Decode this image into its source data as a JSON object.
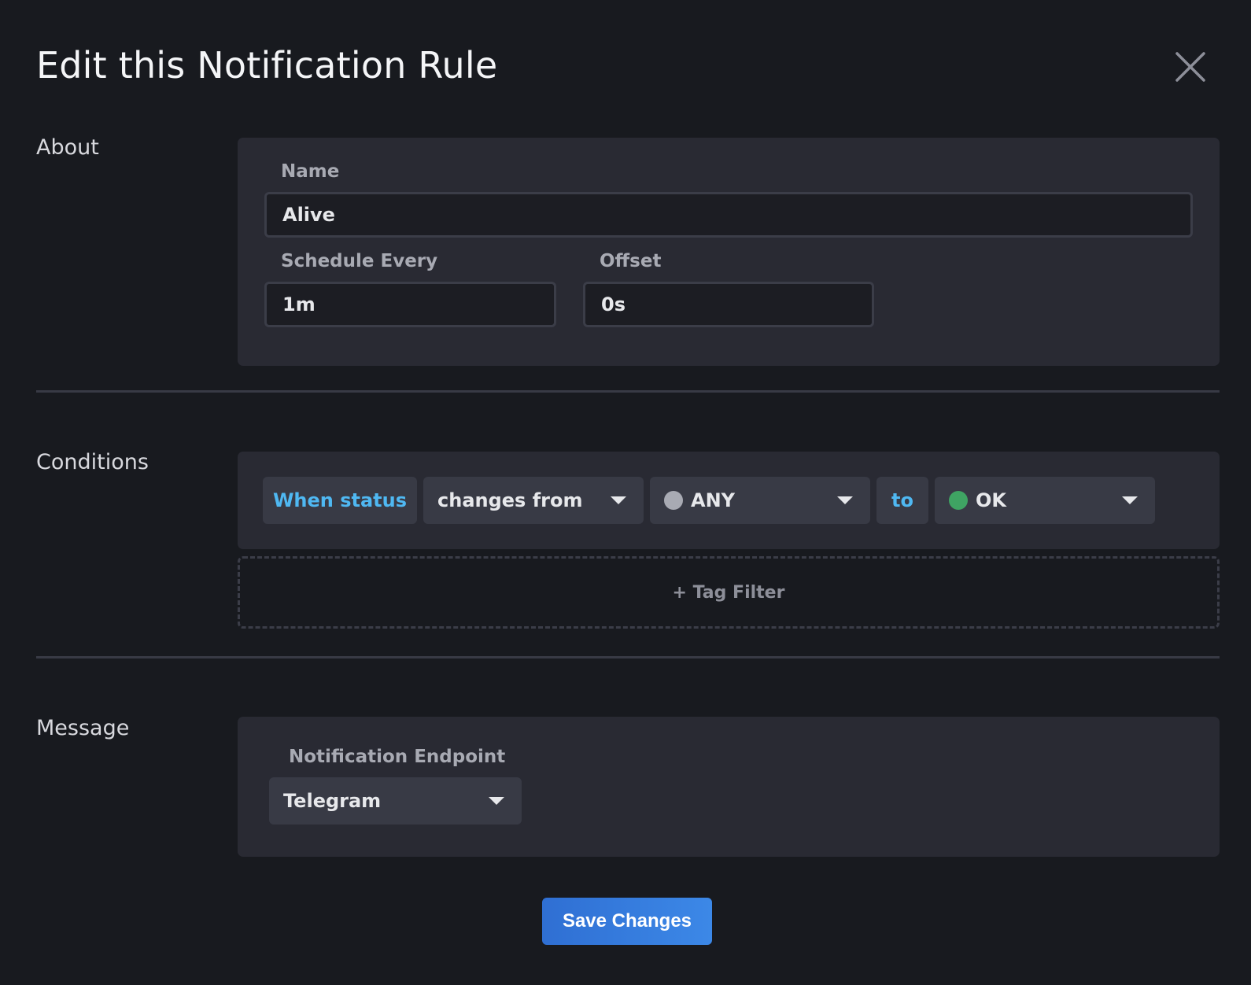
{
  "dialog": {
    "title": "Edit this Notification Rule",
    "close_icon": "close-icon"
  },
  "about": {
    "section_label": "About",
    "name_label": "Name",
    "name_value": "Alive",
    "schedule_label": "Schedule Every",
    "schedule_value": "1m",
    "offset_label": "Offset",
    "offset_value": "0s"
  },
  "conditions": {
    "section_label": "Conditions",
    "when_status": "When status",
    "operator": "changes from",
    "from_status": "ANY",
    "from_color": "#a8aab3",
    "to_label": "to",
    "to_status": "OK",
    "to_color": "#3fa463",
    "tag_filter": "+ Tag Filter"
  },
  "message": {
    "section_label": "Message",
    "endpoint_label": "Notification Endpoint",
    "endpoint_value": "Telegram"
  },
  "footer": {
    "save_label": "Save Changes"
  },
  "colors": {
    "accent_blue": "#4fb8f2",
    "primary_button": "#3c88e7"
  }
}
